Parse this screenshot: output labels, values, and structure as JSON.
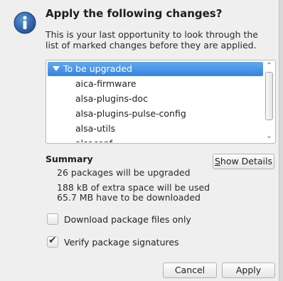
{
  "dialog": {
    "title": "Apply the following changes?",
    "description": "This is your last opportunity to look through the list of marked changes before they are applied."
  },
  "package_list": {
    "group_label": "To be upgraded",
    "items": [
      "aica-firmware",
      "alsa-plugins-doc",
      "alsa-plugins-pulse-config",
      "alsa-utils",
      "alsaconf"
    ]
  },
  "summary": {
    "title": "Summary",
    "show_details_label": "Show Details",
    "show_details_mnemonic": "S",
    "show_details_rest": "how Details",
    "upgrade_count_text": "26 packages will be upgraded",
    "space_text": "188 kB of extra space will be used",
    "download_text": "65.7 MB have to be downloaded"
  },
  "options": {
    "download_only": {
      "label": "Download package files only",
      "checked": false
    },
    "verify_signatures": {
      "label": "Verify package signatures",
      "checked": true
    }
  },
  "buttons": {
    "cancel": "Cancel",
    "apply": "Apply"
  },
  "icons": {
    "dialog_icon": "info-icon",
    "expand": "triangle-down-icon",
    "scroll_up": "chevron-up-icon",
    "scroll_down": "chevron-down-icon",
    "check": "checkmark-icon"
  },
  "colors": {
    "selection": "#3584e4",
    "info_icon": "#2a63a8"
  }
}
